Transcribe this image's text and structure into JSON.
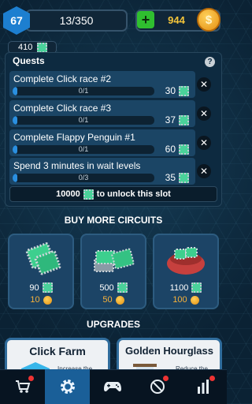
{
  "header": {
    "level": "67",
    "xp_progress": "13/350",
    "coins": "944",
    "circuits": "410"
  },
  "quests": {
    "title": "Quests",
    "help_label": "?",
    "items": [
      {
        "name": "Complete Click race #2",
        "progress": "0/1",
        "reward": "30"
      },
      {
        "name": "Complete Click race #3",
        "progress": "0/1",
        "reward": "37"
      },
      {
        "name": "Complete Flappy Penguin #1",
        "progress": "0/1",
        "reward": "60"
      },
      {
        "name": "Spend 3 minutes in wait levels",
        "progress": "0/3",
        "reward": "35"
      }
    ],
    "unlock_cost": "10000",
    "unlock_text": "to unlock this slot"
  },
  "shop": {
    "title": "BUY MORE CIRCUITS",
    "items": [
      {
        "circuits": "90",
        "coins": "10"
      },
      {
        "circuits": "500",
        "coins": "50"
      },
      {
        "circuits": "1100",
        "coins": "100"
      }
    ]
  },
  "upgrades": {
    "title": "UPGRADES",
    "items": [
      {
        "name": "Click Farm",
        "desc": "Increase the"
      },
      {
        "name": "Golden Hourglass",
        "desc": "Reduce the"
      }
    ]
  },
  "colors": {
    "accent": "#2a8fe0",
    "coin": "#f4c43a",
    "plus": "#2fbf2f"
  }
}
